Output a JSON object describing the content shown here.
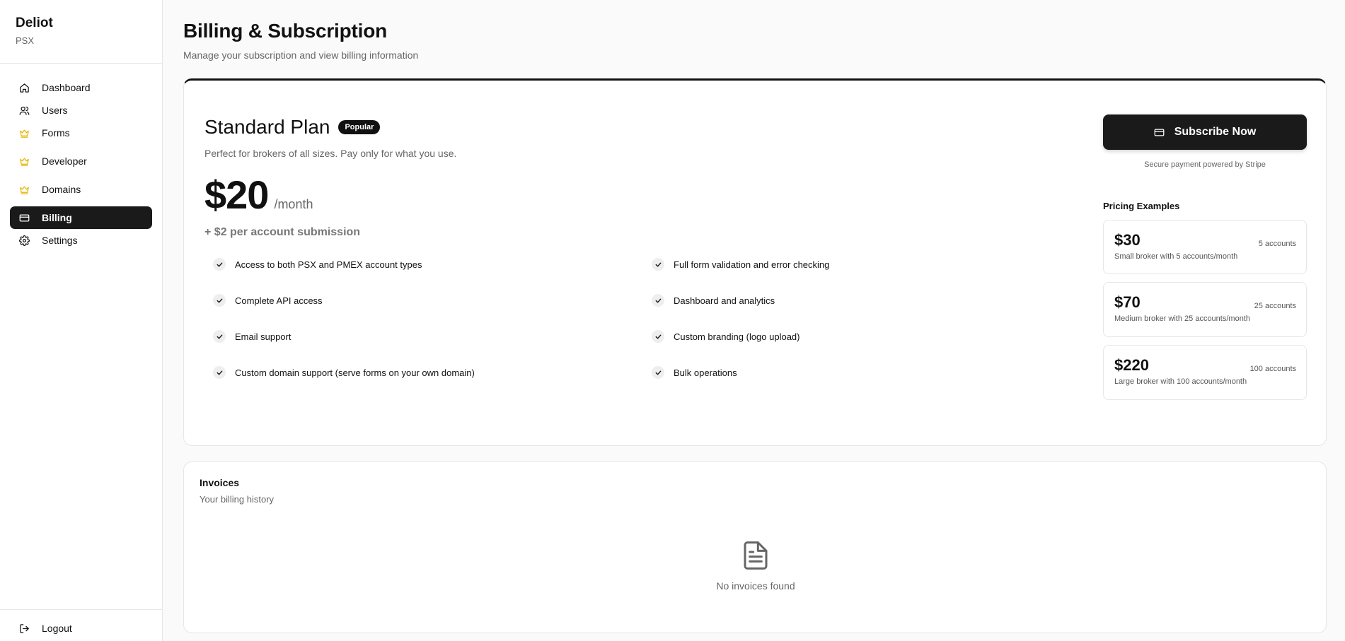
{
  "brand": {
    "name": "Deliot",
    "sub": "PSX"
  },
  "nav": [
    {
      "label": "Dashboard",
      "icon": "home-icon"
    },
    {
      "label": "Users",
      "icon": "users-icon"
    },
    {
      "label": "Forms",
      "icon": "crown-icon"
    },
    {
      "label": "Developer",
      "icon": "crown-icon"
    },
    {
      "label": "Domains",
      "icon": "crown-icon"
    },
    {
      "label": "Billing",
      "icon": "credit-card-icon",
      "active": true
    },
    {
      "label": "Settings",
      "icon": "gear-icon"
    }
  ],
  "logout": {
    "label": "Logout",
    "icon": "logout-icon"
  },
  "header": {
    "title": "Billing & Subscription",
    "subtitle": "Manage your subscription and view billing information"
  },
  "plan": {
    "title": "Standard Plan",
    "badge": "Popular",
    "description": "Perfect for brokers of all sizes. Pay only for what you use.",
    "price": "$20",
    "period": "/month",
    "extra": "+ $2 per account submission",
    "features": [
      "Access to both PSX and PMEX account types",
      "Full form validation and error checking",
      "Complete API access",
      "Dashboard and analytics",
      "Email support",
      "Custom branding (logo upload)",
      "Custom domain support (serve forms on your own domain)",
      "Bulk operations"
    ],
    "subscribe_label": "Subscribe Now",
    "stripe_note": "Secure payment powered by Stripe",
    "examples_title": "Pricing Examples",
    "examples": [
      {
        "price": "$30",
        "accounts": "5 accounts",
        "desc": "Small broker with 5 accounts/month"
      },
      {
        "price": "$70",
        "accounts": "25 accounts",
        "desc": "Medium broker with 25 accounts/month"
      },
      {
        "price": "$220",
        "accounts": "100 accounts",
        "desc": "Large broker with 100 accounts/month"
      }
    ]
  },
  "invoices": {
    "title": "Invoices",
    "subtitle": "Your billing history",
    "empty_text": "No invoices found"
  },
  "colors": {
    "accent": "#1a1a1a",
    "crown": "#e6b400"
  }
}
